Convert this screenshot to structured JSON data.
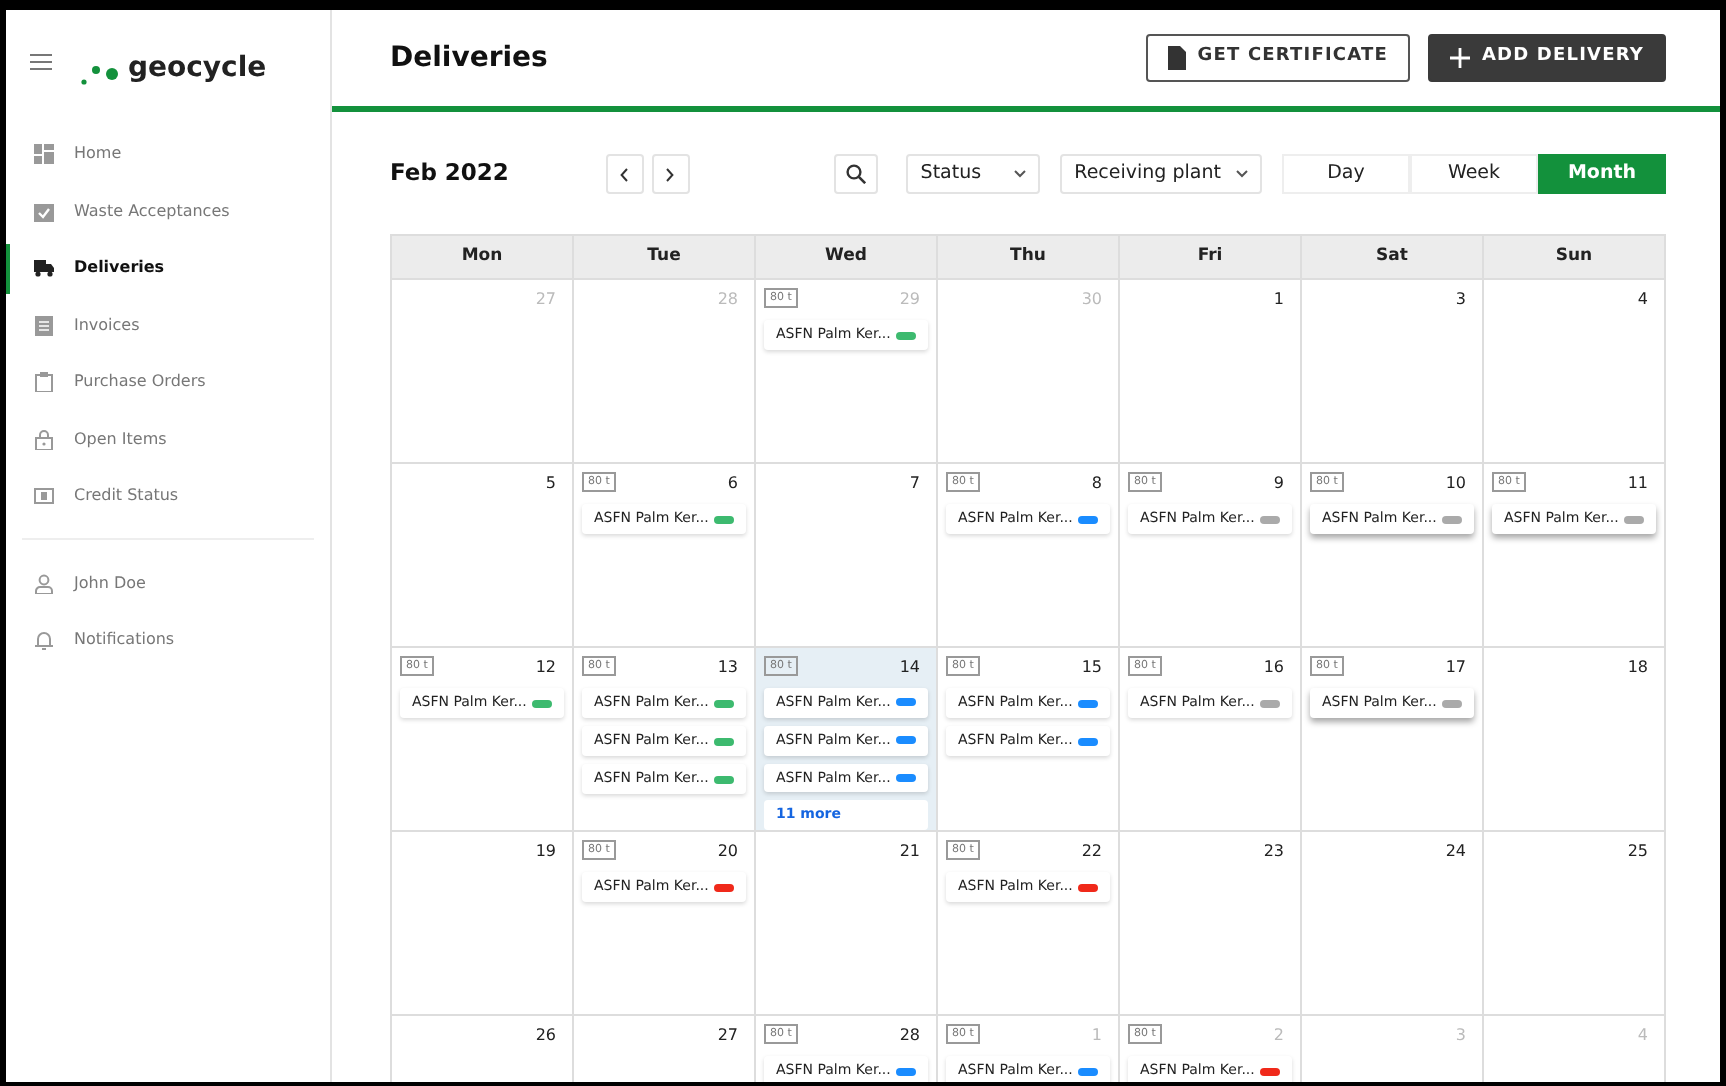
{
  "sidebar": {
    "logo": "geocycle",
    "items": [
      {
        "label": "Home",
        "kind": "grid",
        "selected": false
      },
      {
        "label": "Waste Acceptances",
        "kind": "clipboard-check",
        "selected": false
      },
      {
        "label": "Deliveries",
        "kind": "truck",
        "selected": true
      },
      {
        "label": "Invoices",
        "kind": "document",
        "selected": false
      },
      {
        "label": "Purchase Orders",
        "kind": "clipboard",
        "selected": false
      },
      {
        "label": "Open Items",
        "kind": "lock",
        "selected": false
      },
      {
        "label": "Credit Status",
        "kind": "money",
        "selected": false
      }
    ],
    "user_items": [
      {
        "label": "John Doe",
        "kind": "person"
      },
      {
        "label": "Notifications",
        "kind": "bell"
      }
    ]
  },
  "header": {
    "title": "Deliveries",
    "buttons": [
      {
        "label": "GET CERTIFICATE",
        "kind": "outline"
      },
      {
        "label": "ADD DELIVERY",
        "kind": "primary"
      }
    ]
  },
  "toolbar": {
    "month": "Feb 2022",
    "filters": [
      {
        "label": "Status"
      },
      {
        "label": "Receiving plant"
      }
    ],
    "views": [
      {
        "label": "Day",
        "selected": false
      },
      {
        "label": "Week",
        "selected": false
      },
      {
        "label": "Month",
        "selected": true
      }
    ]
  },
  "calendar": {
    "weekdays": [
      "Mon",
      "Tue",
      "Wed",
      "Thu",
      "Fri",
      "Sat",
      "Sun"
    ],
    "weeks": [
      [
        {
          "date": "27",
          "muted": true,
          "today": false
        },
        {
          "date": "28",
          "muted": true,
          "today": false
        },
        {
          "date": "29",
          "muted": true,
          "today": false,
          "weight": "80 t",
          "events": [
            {
              "label": "ASFN Palm Ker...",
              "color": "#3dba6f",
              "raised": false
            }
          ]
        },
        {
          "date": "30",
          "muted": true,
          "today": false
        },
        {
          "date": "1",
          "muted": false,
          "today": false
        },
        {
          "date": "3",
          "muted": false,
          "today": false
        },
        {
          "date": "4",
          "muted": false,
          "today": false
        }
      ],
      [
        {
          "date": "5",
          "muted": false,
          "today": false
        },
        {
          "date": "6",
          "muted": false,
          "today": false,
          "weight": "80 t",
          "events": [
            {
              "label": "ASFN Palm Ker...",
              "color": "#3dba6f",
              "raised": false
            }
          ]
        },
        {
          "date": "7",
          "muted": false,
          "today": false
        },
        {
          "date": "8",
          "muted": false,
          "today": false,
          "weight": "80 t",
          "events": [
            {
              "label": "ASFN Palm Ker...",
              "color": "#1a8cff",
              "raised": false
            }
          ]
        },
        {
          "date": "9",
          "muted": false,
          "today": false,
          "weight": "80 t",
          "events": [
            {
              "label": "ASFN Palm Ker...",
              "color": "#aaaaaa",
              "raised": false
            }
          ]
        },
        {
          "date": "10",
          "muted": false,
          "today": false,
          "weight": "80 t",
          "events": [
            {
              "label": "ASFN Palm Ker...",
              "color": "#aaaaaa",
              "raised": true
            }
          ]
        },
        {
          "date": "11",
          "muted": false,
          "today": false,
          "weight": "80 t",
          "events": [
            {
              "label": "ASFN Palm Ker...",
              "color": "#aaaaaa",
              "raised": true
            }
          ]
        }
      ],
      [
        {
          "date": "12",
          "muted": false,
          "today": false,
          "weight": "80 t",
          "events": [
            {
              "label": "ASFN Palm Ker...",
              "color": "#3dba6f",
              "raised": false
            }
          ]
        },
        {
          "date": "13",
          "muted": false,
          "today": false,
          "weight": "80 t",
          "events": [
            {
              "label": "ASFN Palm Ker...",
              "color": "#3dba6f",
              "raised": false
            },
            {
              "label": "ASFN Palm Ker...",
              "color": "#3dba6f",
              "raised": false
            },
            {
              "label": "ASFN Palm Ker...",
              "color": "#3dba6f",
              "raised": false
            }
          ]
        },
        {
          "date": "14",
          "muted": false,
          "today": true,
          "weight": "80 t",
          "events": [
            {
              "label": "ASFN Palm Ker...",
              "color": "#1a8cff",
              "raised": false
            },
            {
              "label": "ASFN Palm Ker...",
              "color": "#1a8cff",
              "raised": false
            },
            {
              "label": "ASFN Palm Ker...",
              "color": "#1a8cff",
              "raised": false
            }
          ],
          "more": "11 more"
        },
        {
          "date": "15",
          "muted": false,
          "today": false,
          "weight": "80 t",
          "events": [
            {
              "label": "ASFN Palm Ker...",
              "color": "#1a8cff",
              "raised": false
            },
            {
              "label": "ASFN Palm Ker...",
              "color": "#1a8cff",
              "raised": false
            }
          ]
        },
        {
          "date": "16",
          "muted": false,
          "today": false,
          "weight": "80 t",
          "events": [
            {
              "label": "ASFN Palm Ker...",
              "color": "#aaaaaa",
              "raised": false
            }
          ]
        },
        {
          "date": "17",
          "muted": false,
          "today": false,
          "weight": "80 t",
          "events": [
            {
              "label": "ASFN Palm Ker...",
              "color": "#aaaaaa",
              "raised": true
            }
          ]
        },
        {
          "date": "18",
          "muted": false,
          "today": false
        }
      ],
      [
        {
          "date": "19",
          "muted": false,
          "today": false
        },
        {
          "date": "20",
          "muted": false,
          "today": false,
          "weight": "80 t",
          "events": [
            {
              "label": "ASFN Palm Ker...",
              "color": "#f0291a",
              "raised": false
            }
          ]
        },
        {
          "date": "21",
          "muted": false,
          "today": false
        },
        {
          "date": "22",
          "muted": false,
          "today": false,
          "weight": "80 t",
          "events": [
            {
              "label": "ASFN Palm Ker...",
              "color": "#f0291a",
              "raised": false
            }
          ]
        },
        {
          "date": "23",
          "muted": false,
          "today": false
        },
        {
          "date": "24",
          "muted": false,
          "today": false
        },
        {
          "date": "25",
          "muted": false,
          "today": false
        }
      ],
      [
        {
          "date": "26",
          "muted": false,
          "today": false
        },
        {
          "date": "27",
          "muted": false,
          "today": false
        },
        {
          "date": "28",
          "muted": false,
          "today": false,
          "weight": "80 t",
          "events": [
            {
              "label": "ASFN Palm Ker...",
              "color": "#1a8cff",
              "raised": false
            }
          ]
        },
        {
          "date": "1",
          "muted": true,
          "today": false,
          "weight": "80 t",
          "events": [
            {
              "label": "ASFN Palm Ker...",
              "color": "#1a8cff",
              "raised": false
            }
          ]
        },
        {
          "date": "2",
          "muted": true,
          "today": false,
          "weight": "80 t",
          "events": [
            {
              "label": "ASFN Palm Ker...",
              "color": "#f0291a",
              "raised": false
            }
          ]
        },
        {
          "date": "3",
          "muted": true,
          "today": false
        },
        {
          "date": "4",
          "muted": true,
          "today": false
        }
      ]
    ]
  }
}
